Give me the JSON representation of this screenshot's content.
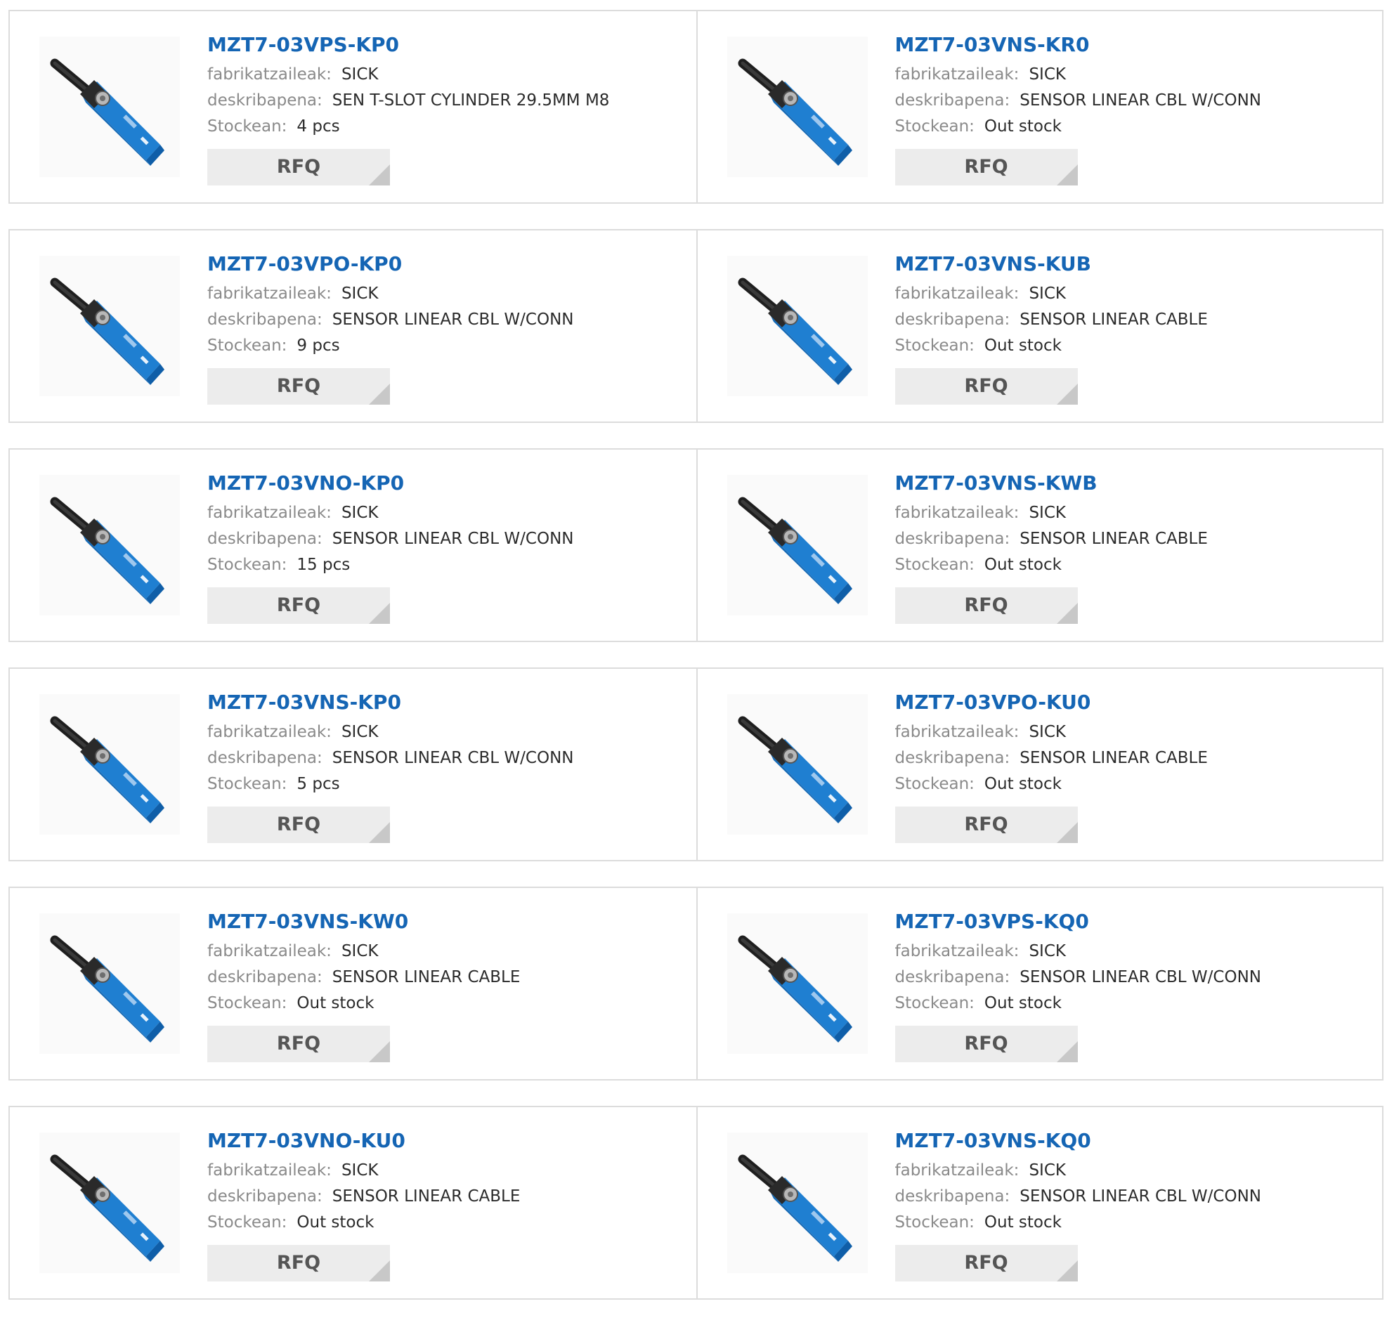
{
  "labels": {
    "manufacturer": "fabrikatzaileak:",
    "description": "deskribapena:",
    "stock": "Stockean:",
    "rfq": "RFQ"
  },
  "colors": {
    "title": "#1565b4",
    "label": "#8a8a8a",
    "value": "#2b2b2b",
    "border": "#dcdcdc",
    "button_bg": "#ececec"
  },
  "products": [
    {
      "part": "MZT7-03VPS-KP0",
      "manufacturer": "SICK",
      "description": "SEN T-SLOT CYLINDER 29.5MM M8",
      "stock": "4 pcs"
    },
    {
      "part": "MZT7-03VNS-KR0",
      "manufacturer": "SICK",
      "description": "SENSOR LINEAR CBL W/CONN",
      "stock": "Out stock"
    },
    {
      "part": "MZT7-03VPO-KP0",
      "manufacturer": "SICK",
      "description": "SENSOR LINEAR CBL W/CONN",
      "stock": "9 pcs"
    },
    {
      "part": "MZT7-03VNS-KUB",
      "manufacturer": "SICK",
      "description": "SENSOR LINEAR CABLE",
      "stock": "Out stock"
    },
    {
      "part": "MZT7-03VNO-KP0",
      "manufacturer": "SICK",
      "description": "SENSOR LINEAR CBL W/CONN",
      "stock": "15 pcs"
    },
    {
      "part": "MZT7-03VNS-KWB",
      "manufacturer": "SICK",
      "description": "SENSOR LINEAR CABLE",
      "stock": "Out stock"
    },
    {
      "part": "MZT7-03VNS-KP0",
      "manufacturer": "SICK",
      "description": "SENSOR LINEAR CBL W/CONN",
      "stock": "5 pcs"
    },
    {
      "part": "MZT7-03VPO-KU0",
      "manufacturer": "SICK",
      "description": "SENSOR LINEAR CABLE",
      "stock": "Out stock"
    },
    {
      "part": "MZT7-03VNS-KW0",
      "manufacturer": "SICK",
      "description": "SENSOR LINEAR CABLE",
      "stock": "Out stock"
    },
    {
      "part": "MZT7-03VPS-KQ0",
      "manufacturer": "SICK",
      "description": "SENSOR LINEAR CBL W/CONN",
      "stock": "Out stock"
    },
    {
      "part": "MZT7-03VNO-KU0",
      "manufacturer": "SICK",
      "description": "SENSOR LINEAR CABLE",
      "stock": "Out stock"
    },
    {
      "part": "MZT7-03VNS-KQ0",
      "manufacturer": "SICK",
      "description": "SENSOR LINEAR CBL W/CONN",
      "stock": "Out stock"
    }
  ]
}
